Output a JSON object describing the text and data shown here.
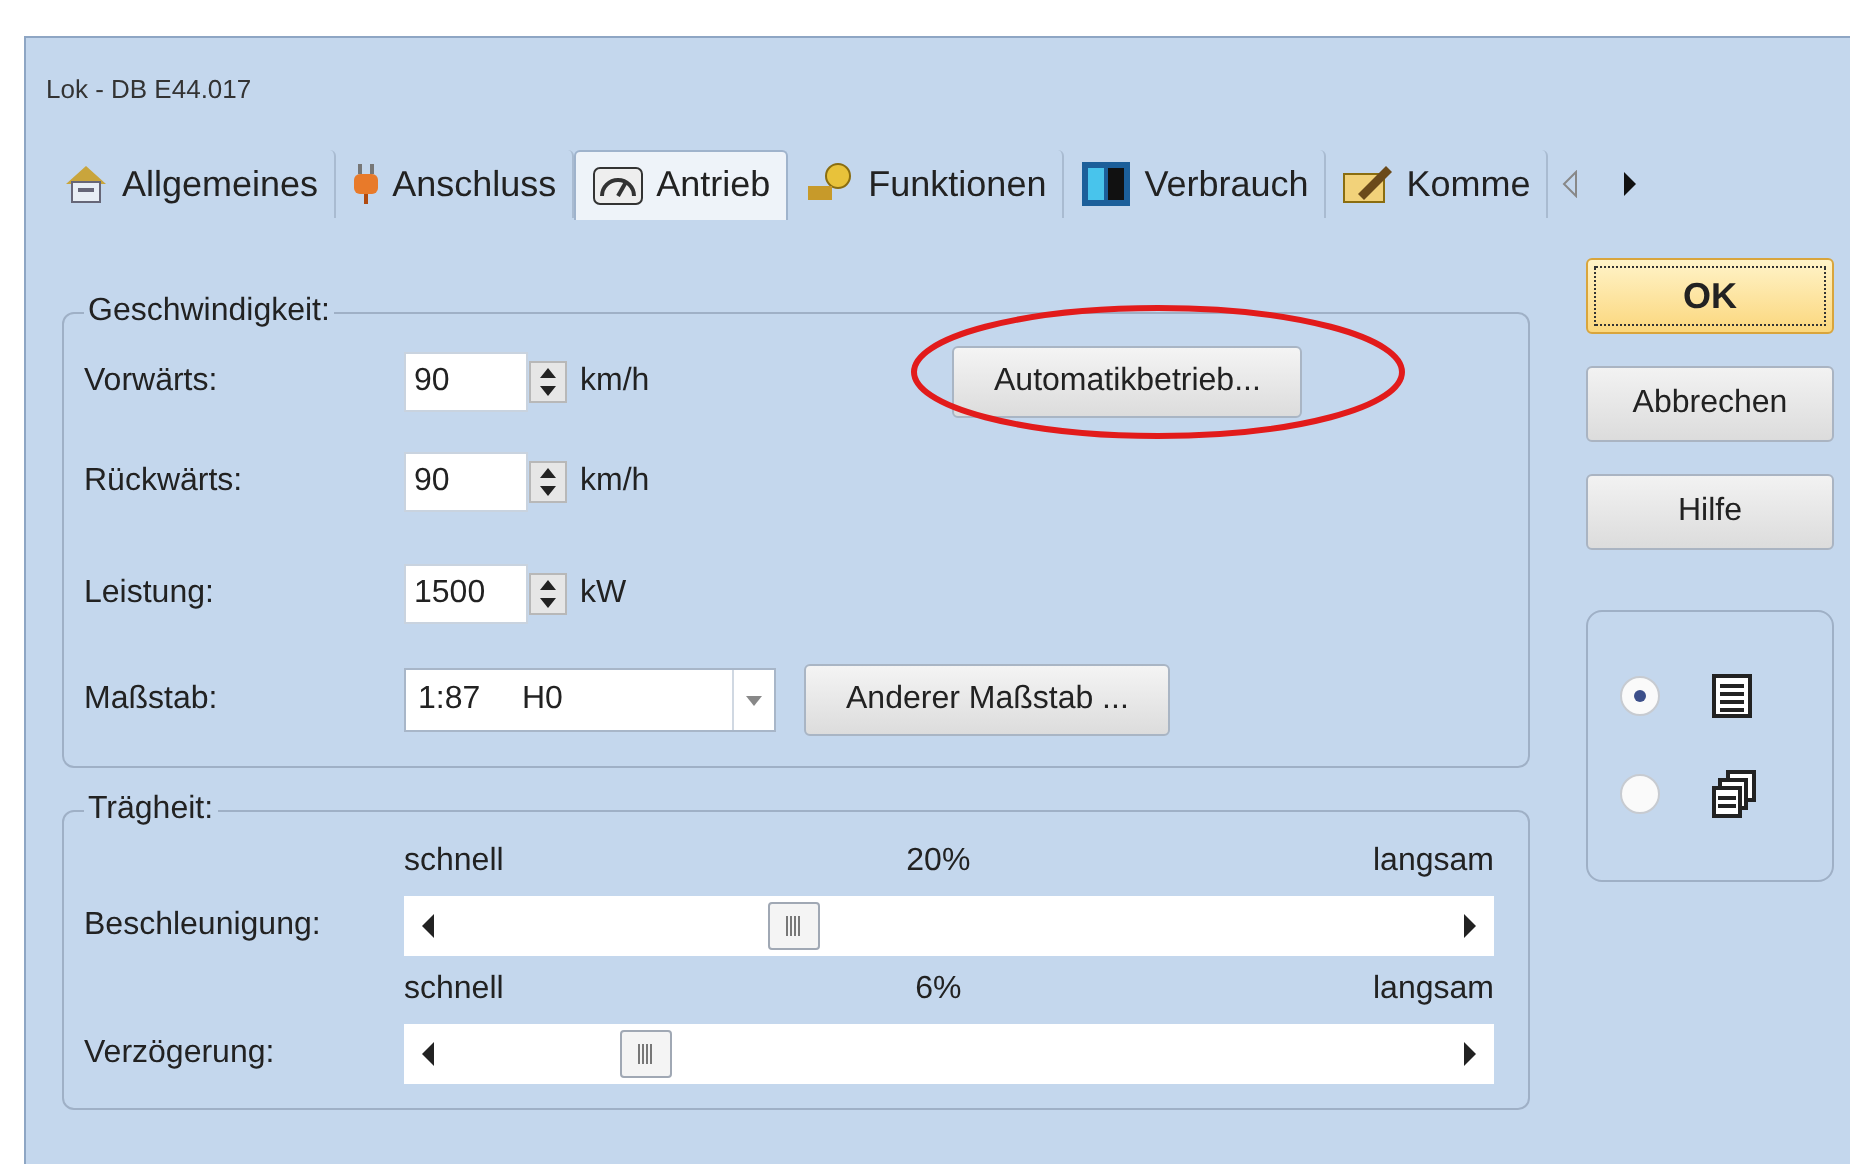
{
  "window": {
    "title": "Lok - DB E44.017"
  },
  "tabs": [
    {
      "label": "Allgemeines",
      "selected": false
    },
    {
      "label": "Anschluss",
      "selected": false
    },
    {
      "label": "Antrieb",
      "selected": true
    },
    {
      "label": "Funktionen",
      "selected": false
    },
    {
      "label": "Verbrauch",
      "selected": false
    },
    {
      "label": "Komme",
      "selected": false
    }
  ],
  "speed_group": {
    "title": "Geschwindigkeit:",
    "fields": [
      {
        "kind": "spin",
        "label": "Vorwärts:",
        "value": "90",
        "unit": "km/h",
        "button": {
          "label": "Automatikbetrieb...",
          "highlighted": true
        }
      },
      {
        "kind": "spin",
        "label": "Rückwärts:",
        "value": "90",
        "unit": "km/h"
      },
      {
        "kind": "spin",
        "label": "Leistung:",
        "value": "1500",
        "unit": "kW"
      },
      {
        "kind": "combo",
        "label": "Maßstab:",
        "value": "1:87",
        "gauge": "H0",
        "button": {
          "label": "Anderer Maßstab ...",
          "highlighted": false
        }
      }
    ]
  },
  "inertia_group": {
    "title": "Trägheit:",
    "sliders": [
      {
        "label": "Beschleunigung:",
        "low": "schnell",
        "reading": "20%",
        "high": "langsam",
        "level": 0.33
      },
      {
        "label": "Verzögerung:",
        "low": "schnell",
        "reading": "6%",
        "high": "langsam",
        "level": 0.18
      }
    ]
  },
  "buttons": [
    {
      "label": "OK",
      "default": true
    },
    {
      "label": "Abbrechen",
      "default": false
    },
    {
      "label": "Hilfe",
      "default": false
    }
  ],
  "view_options": [
    {
      "selected": true
    },
    {
      "selected": false
    }
  ]
}
